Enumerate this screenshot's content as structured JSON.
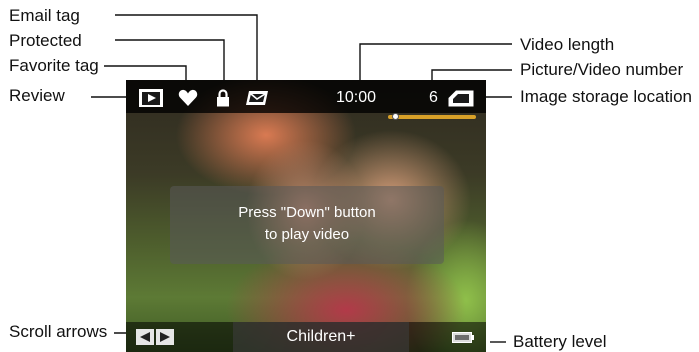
{
  "callouts": {
    "email_tag": "Email tag",
    "protected": "Protected",
    "favorite_tag": "Favorite tag",
    "review": "Review",
    "scroll_arrows": "Scroll arrows",
    "video_length": "Video length",
    "picture_video_number": "Picture/Video number",
    "image_storage_location": "Image storage location",
    "battery_level": "Battery level"
  },
  "screen": {
    "video_length": "10:00",
    "picture_number": "6",
    "message_line1": "Press \"Down\" button",
    "message_line2": "to play video",
    "album_label": "Children+",
    "video_progress": 0.05
  },
  "icons": {
    "review": "play-review-icon",
    "favorite": "heart-icon",
    "protected": "lock-icon",
    "email": "email-envelope-icon",
    "storage": "memory-card-icon",
    "scroll": "left-right-arrows-icon",
    "battery": "battery-icon"
  },
  "colors": {
    "leader_line": "#111111",
    "overlay_bar": "#000000",
    "progress_bar": "#d9a128"
  }
}
